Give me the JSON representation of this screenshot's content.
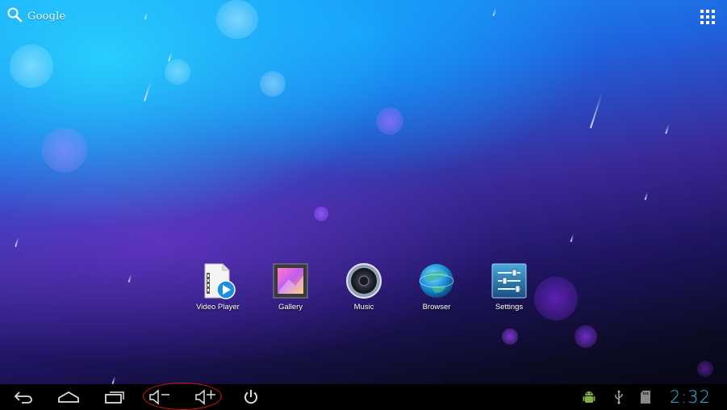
{
  "search": {
    "label": "Google",
    "icon": "search-icon"
  },
  "launcher": {
    "apps_icon": "all-apps-icon"
  },
  "apps": [
    {
      "label": "Video Player",
      "icon": "video-player-icon"
    },
    {
      "label": "Gallery",
      "icon": "gallery-icon"
    },
    {
      "label": "Music",
      "icon": "music-speaker-icon"
    },
    {
      "label": "Browser",
      "icon": "globe-icon"
    },
    {
      "label": "Settings",
      "icon": "settings-sliders-icon"
    }
  ],
  "navbar": {
    "buttons": [
      "back-icon",
      "home-icon",
      "recent-apps-icon",
      "volume-down-icon",
      "volume-up-icon",
      "power-icon"
    ],
    "status_icons": [
      "android-debug-icon",
      "usb-icon",
      "sd-card-icon"
    ],
    "clock": "2:32"
  },
  "colors": {
    "clock": "#33b5e5",
    "annotation": "#dd1111",
    "navbar_bg": "#000000"
  }
}
